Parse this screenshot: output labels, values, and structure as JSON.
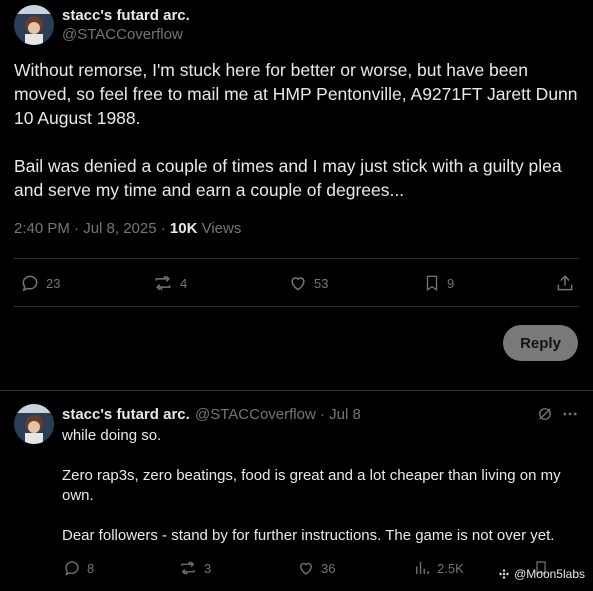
{
  "main_tweet": {
    "author_name": "stacc's futard arc.",
    "author_handle": "@STACCoverflow",
    "paragraphs": [
      "Without remorse, I'm stuck here for better or worse, but have been moved, so feel free to mail me at HMP Pentonville, A9271FT Jarett Dunn 10 August 1988.",
      "Bail was denied a couple of times and I may just stick with a guilty plea and serve my time and earn a couple of degrees..."
    ],
    "time": "2:40 PM · Jul 8, 2025 · ",
    "views_count": "10K",
    "views_label": " Views",
    "actions": {
      "replies": "23",
      "reposts": "4",
      "likes": "53",
      "bookmarks": "9"
    },
    "reply_button": "Reply"
  },
  "reply_tweet": {
    "author_name": "stacc's futard arc.",
    "author_handle_date": "@STACCoverflow · Jul 8",
    "paragraphs": [
      "while doing so.",
      "Zero rap3s, zero beatings, food is great and a lot cheaper than living on my own.",
      "Dear followers - stand by for further instructions. The game is not over yet."
    ],
    "actions": {
      "replies": "8",
      "reposts": "3",
      "likes": "36",
      "views": "2.5K"
    }
  },
  "watermark": "@Moon5labs",
  "colors": {
    "background": "#000000",
    "text": "#e7e9ea",
    "muted": "#71767b",
    "border": "#2f3336",
    "reply_button_bg": "#787a7a"
  }
}
